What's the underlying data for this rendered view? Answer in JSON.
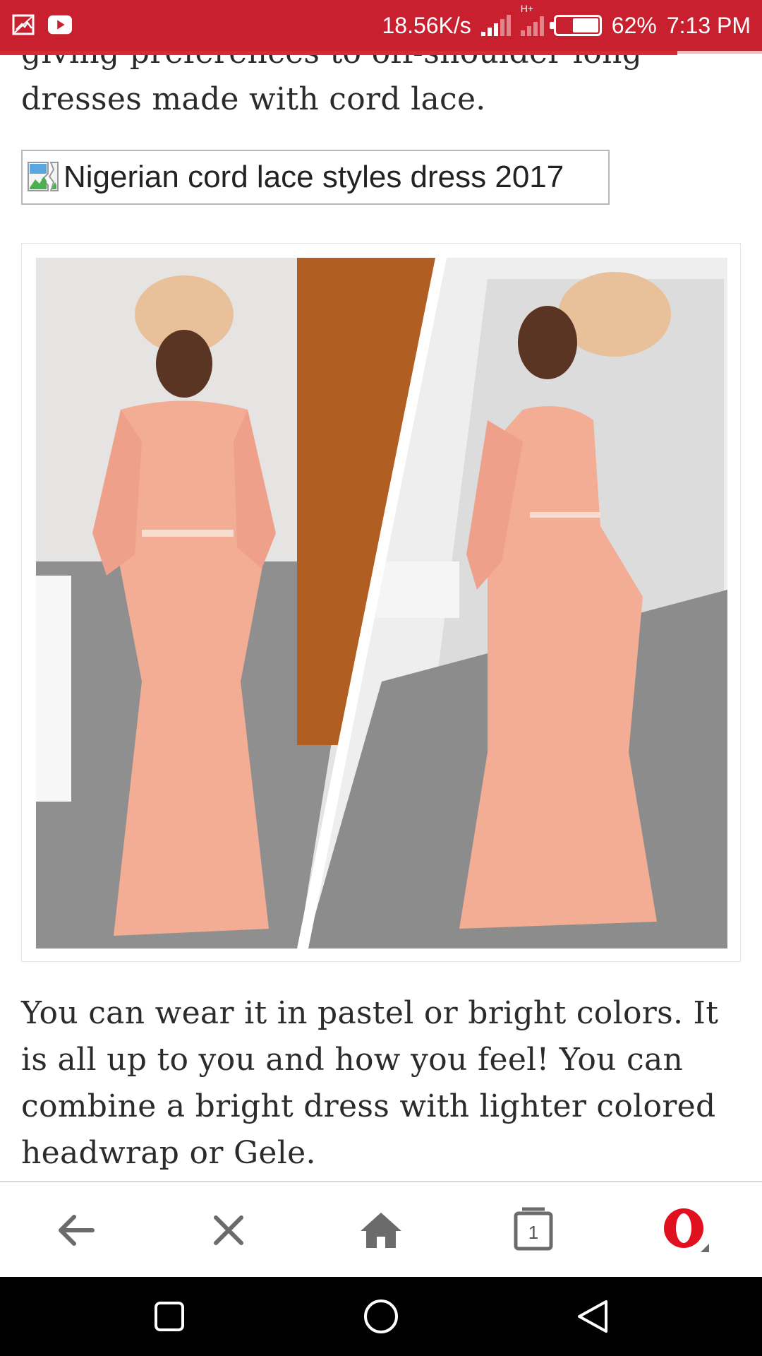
{
  "status_bar": {
    "network_speed": "18.56K/s",
    "network_type": "H+",
    "battery_percent": "62%",
    "battery_level": 0.62,
    "time": "7:13 PM",
    "background_color": "#c8202e",
    "left_icons": [
      "screenshot-icon",
      "youtube-icon"
    ]
  },
  "article": {
    "paragraph_top": "giving preferences to off-shoulder long dresses made with cord lace.",
    "broken_image_alt": "Nigerian cord lace styles dress 2017",
    "paragraph_bottom": "You can wear it in pastel or bright colors. It is all up to you and how you feel! You can combine a bright dress with lighter colored headwrap or Gele."
  },
  "browser_bar": {
    "tab_count": "1",
    "buttons": [
      "back-arrow-icon",
      "close-icon",
      "home-icon",
      "tabs-icon",
      "opera-menu-icon"
    ],
    "accent_color": "#e0101e"
  }
}
